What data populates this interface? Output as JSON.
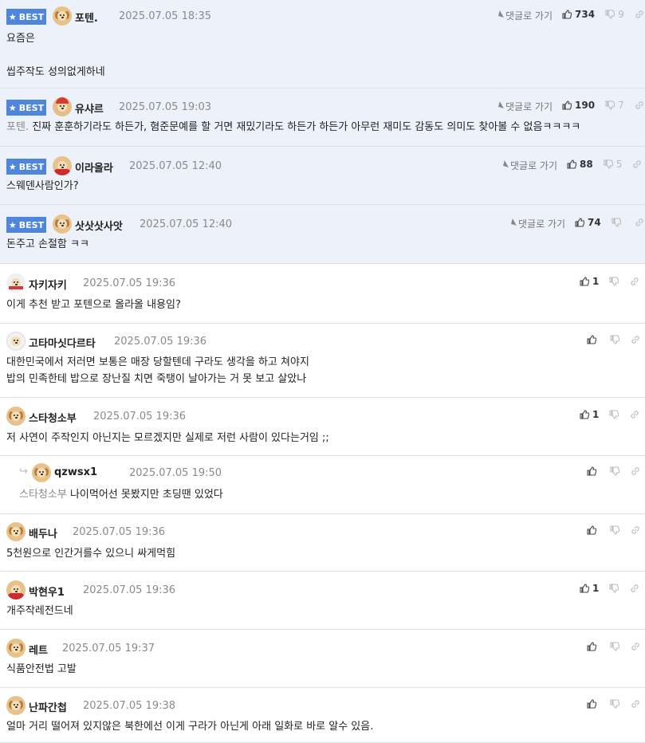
{
  "labels": {
    "best": "BEST",
    "goto": "댓글로 가기"
  },
  "comments": [
    {
      "nick": "포텐.",
      "date": "2025.07.05 18:35",
      "best": true,
      "up": "734",
      "down": "9",
      "avatar": "dog",
      "lines": [
        "요즘은",
        "",
        "씹주작도 성의없게하네"
      ]
    },
    {
      "nick": "유샤르",
      "date": "2025.07.05 19:03",
      "best": true,
      "up": "190",
      "down": "7",
      "avatar": "santa",
      "ref": "포텐.",
      "lines": [
        "진짜 훈훈하기라도 하든가, 혐준문예를 할 거면 재밌기라도 하든가 하든가 아무런 재미도 감동도 의미도 찾아볼 수 없음ㅋㅋㅋㅋ"
      ]
    },
    {
      "nick": "이라올라",
      "date": "2025.07.05 12:40",
      "best": true,
      "up": "88",
      "down": "5",
      "avatar": "red",
      "lines": [
        "스웨덴사람인가?"
      ]
    },
    {
      "nick": "삿삿삿사앗",
      "date": "2025.07.05 12:40",
      "best": true,
      "up": "74",
      "down": "",
      "avatar": "dog",
      "lines": [
        "돈주고 손절함 ㅋㅋ"
      ]
    },
    {
      "nick": "자키자키",
      "date": "2025.07.05 19:36",
      "up": "1",
      "avatar": "bear",
      "lines": [
        "이게 추천 받고 포텐으로 올라올 내용임?"
      ]
    },
    {
      "nick": "고타마싯다르타",
      "date": "2025.07.05 19:36",
      "up": "",
      "avatar": "wolf",
      "lines": [
        "대한민국에서 저러면 보통은 매장 당할텐데 구라도 생각을 하고 쳐야지",
        "밥의 민족한테 밥으로 장난질 치면 죽탱이 날아가는 거 못 보고 살았나"
      ]
    },
    {
      "nick": "스타청소부",
      "date": "2025.07.05 19:36",
      "up": "1",
      "avatar": "dog",
      "lines": [
        "저 사연이 주작인지 아닌지는 모르겠지만 실제로 저런 사람이 있다는거임 ;;"
      ]
    },
    {
      "nick": "qzwsx1",
      "date": "2025.07.05 19:50",
      "up": "",
      "avatar": "dog",
      "reply": true,
      "ref": "스타청소부",
      "lines": [
        "나이먹어선 못봤지만 초딩땐 있었다"
      ]
    },
    {
      "nick": "배두나",
      "date": "2025.07.05 19:36",
      "up": "",
      "avatar": "dog",
      "lines": [
        "5천원으로 인간거를수 있으니 싸게먹힘"
      ]
    },
    {
      "nick": "박현우1",
      "date": "2025.07.05 19:36",
      "up": "1",
      "avatar": "red",
      "lines": [
        "개주작레전드네"
      ]
    },
    {
      "nick": "레트",
      "date": "2025.07.05 19:37",
      "up": "",
      "avatar": "dog",
      "lines": [
        "식품안전법 고발"
      ]
    },
    {
      "nick": "난파간첩",
      "date": "2025.07.05 19:38",
      "up": "",
      "avatar": "dog",
      "lines": [
        "얼마 거리 떨어져 있지않은 북한에선 이게 구라가 아닌게 아래 일화로 바로 알수 있음."
      ]
    }
  ]
}
